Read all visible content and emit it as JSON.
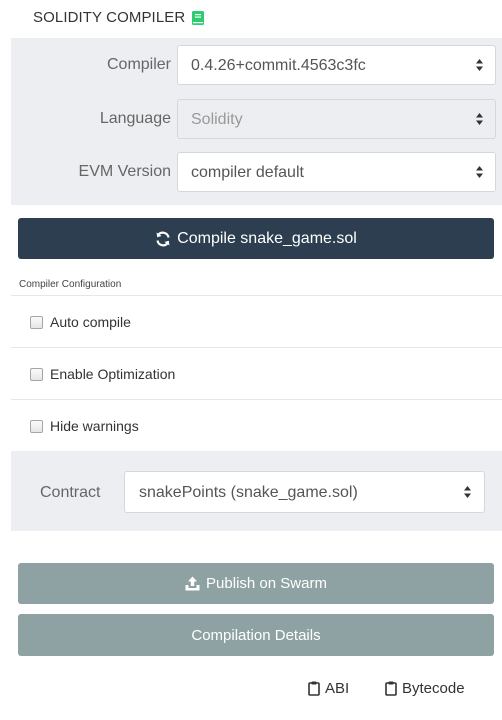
{
  "header": {
    "title": "SOLIDITY COMPILER",
    "icon": "book-icon",
    "icon_color": "#2ecc71"
  },
  "settings": {
    "compiler": {
      "label": "Compiler",
      "value": "0.4.26+commit.4563c3fc"
    },
    "language": {
      "label": "Language",
      "value": "Solidity"
    },
    "evm_version": {
      "label": "EVM Version",
      "value": "compiler default"
    }
  },
  "compile_button": {
    "label": "Compile snake_game.sol",
    "icon": "refresh-icon"
  },
  "configuration": {
    "title": "Compiler Configuration",
    "options": [
      {
        "label": "Auto compile",
        "checked": false
      },
      {
        "label": "Enable Optimization",
        "checked": false
      },
      {
        "label": "Hide warnings",
        "checked": false
      }
    ]
  },
  "contract": {
    "label": "Contract",
    "value": "snakePoints (snake_game.sol)"
  },
  "publish_button": {
    "label": "Publish on Swarm",
    "icon": "upload-icon"
  },
  "details_button": {
    "label": "Compilation Details"
  },
  "footer": {
    "abi_label": "ABI",
    "bytecode_label": "Bytecode"
  },
  "colors": {
    "primary_button": "#2c3e50",
    "secondary_button": "#8fa2a3",
    "panel_background": "#eceef1"
  }
}
